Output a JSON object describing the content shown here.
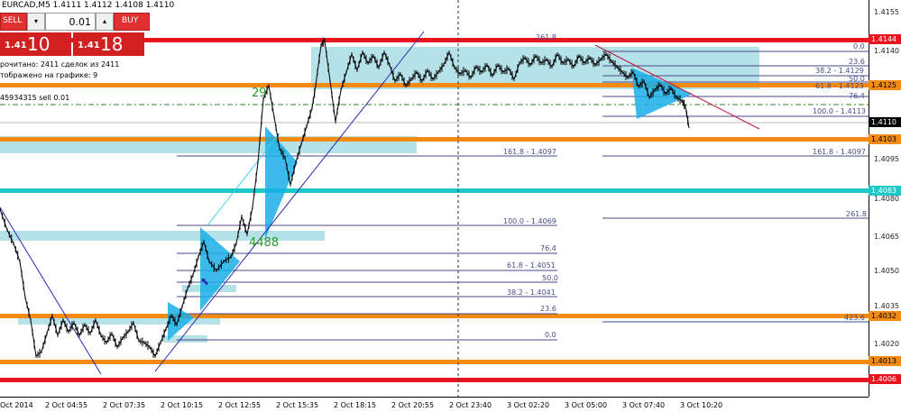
{
  "header": {
    "title": "EURCAD,M5  1.4111 1.4112 1.4108 1.4110"
  },
  "trade_panel": {
    "sell_label": "SELL",
    "buy_label": "BUY",
    "lot_value": "0.01",
    "down_arrow": "▾",
    "up_arrow": "▴",
    "sell_price_prefix": "1.41",
    "sell_price_main": "10",
    "buy_price_prefix": "1.41",
    "buy_price_main": "18"
  },
  "info": {
    "line1": "рочитано: 2411 сделок из 2411",
    "line2": "тображено на графике: 9",
    "order": "45934315 sell 0.01"
  },
  "price_axis": {
    "ticks": [
      "1.4155",
      "1.4140",
      "1.4095",
      "1.4080",
      "1.4065",
      "1.4050",
      "1.4035",
      "1.4020"
    ],
    "tags": [
      {
        "text": "1.4144",
        "bg": "#e8141e",
        "color": "#ffffff"
      },
      {
        "text": "1.4125",
        "bg": "#f28a14",
        "color": "#000000"
      },
      {
        "text": "1.4110",
        "bg": "#000000",
        "color": "#ffffff"
      },
      {
        "text": "1.4103",
        "bg": "#f28a14",
        "color": "#000000"
      },
      {
        "text": "1.4083",
        "bg": "#1ec8c8",
        "color": "#ffffff"
      },
      {
        "text": "1.4032",
        "bg": "#f28a14",
        "color": "#000000"
      },
      {
        "text": "1.4013",
        "bg": "#f28a14",
        "color": "#000000"
      },
      {
        "text": "1.4006",
        "bg": "#e8141e",
        "color": "#ffffff"
      }
    ]
  },
  "time_axis": [
    "Oct 2014",
    "2 Oct 04:55",
    "2 Oct 07:35",
    "2 Oct 10:15",
    "2 Oct 12:55",
    "2 Oct 15:35",
    "2 Oct 18:15",
    "2 Oct 20:55",
    "2 Oct 23:40",
    "3 Oct 02:20",
    "3 Oct 05:00",
    "3 Oct 07:40",
    "3 Oct 10:20"
  ],
  "fib_left": {
    "l1": "161.8 - 1.4097",
    "l2": "100.0 - 1.4069",
    "l3": "76.4",
    "l4": "61.8 - 1.4051",
    "l5": "50.0",
    "l6": "38.2 - 1.4041",
    "l7": "23.6",
    "l8": "0.0",
    "top": "261.8"
  },
  "fib_right": {
    "r0": "0.0",
    "r1": "23.6",
    "r2": "38.2 - 1.4129",
    "r3": "50.0",
    "r4": "61.8 - 1.4123",
    "r5": "76.4",
    "r6": "100.0 - 1.4113",
    "r7": "161.8 - 1.4097",
    "r8": "261.8",
    "r9": "423.6"
  },
  "annotations": {
    "n1": "29",
    "n2": "4488"
  },
  "colors": {
    "red": "#e8141e",
    "orange": "#f28a14",
    "cyan": "#1ec8c8",
    "zone": "#a8dce4",
    "triangle": "#1aaee8"
  }
}
